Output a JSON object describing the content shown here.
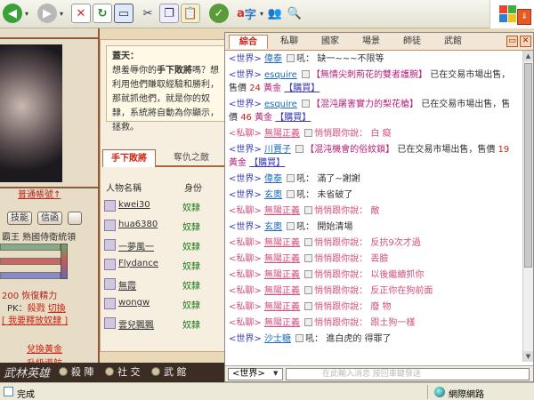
{
  "game": {
    "tab_number": "2",
    "left": {
      "link": "普通帳號↑",
      "buttons": [
        "技能",
        "信函"
      ],
      "king_line": "霸王 熟國侍衛統領",
      "vigor": "200 恢復精力",
      "pk_label": "PK：",
      "pk_value": "殺戮",
      "pk_switch": "切換",
      "release_link": "[ 我要釋放奴隸 ]",
      "gold_link": "兌換黃金",
      "upgrade_link": "升級導航"
    },
    "notice": {
      "title": "蓋天：",
      "text_before": "想羞辱你的",
      "text_bold": "手下敗將",
      "text_after": "嗎？想利用他們賺取經驗和勝利，那就抓他們，就是你的奴隸，系統將自動為你顯示，拯救。"
    },
    "subtabs": [
      "手下敗將",
      "奪仇之敵"
    ],
    "list_headers": [
      "人物名稱",
      "身份"
    ],
    "list_rows": [
      {
        "name": "kwei30",
        "status": "奴隸"
      },
      {
        "name": "hua6380",
        "status": "奴隸"
      },
      {
        "name": "一夢風一",
        "status": "奴隸"
      },
      {
        "name": "Flydance",
        "status": "奴隸"
      },
      {
        "name": "無霞",
        "status": "奴隸"
      },
      {
        "name": "wongw",
        "status": "奴隸"
      },
      {
        "name": "雲兒飄飄",
        "status": "奴隸"
      }
    ],
    "bottom_menu": [
      "殺 陣",
      "社 交",
      "武 館"
    ],
    "logo": "武林英雄"
  },
  "chat": {
    "tabs": [
      "綜合",
      "私聊",
      "國家",
      "場景",
      "師徒",
      "武館"
    ],
    "active_tab": "綜合",
    "channel": "<世界>",
    "input_placeholder": "在此輸入消息 按回車鍵發送",
    "messages": [
      {
        "type": "shout",
        "channel": "<世界>",
        "user": "偉泰",
        "verb": "吼：",
        "text": "缺一~~~不限等"
      },
      {
        "type": "trade",
        "channel": "<世界>",
        "user": "esquire",
        "item": "【無情尖刺荊花的雙者護腕】",
        "mid": "已在交易市場出售，售價",
        "price": "24",
        "unit": "黃金",
        "buy": "【購買】"
      },
      {
        "type": "trade",
        "channel": "<世界>",
        "user": "esquire",
        "item": "【混沌屠害實力的梨花槍】",
        "mid": "已在交易市場出售，售價",
        "price": "46",
        "unit": "黃金",
        "buy": "【購買】"
      },
      {
        "type": "private",
        "channel": "<私聊>",
        "user": "無陽正義",
        "verb": "悄悄跟你說：",
        "text": "白 癡"
      },
      {
        "type": "trade",
        "channel": "<世界>",
        "user": "川賈子",
        "item": "【混沌機會的俗紋鎖】",
        "mid": "已在交易市場出售，售價",
        "price": "19",
        "unit": "黃金",
        "buy": "【購買】"
      },
      {
        "type": "shout",
        "channel": "<世界>",
        "user": "偉泰",
        "verb": "吼：",
        "text": "滿了~謝謝"
      },
      {
        "type": "shout",
        "channel": "<世界>",
        "user": "玄奧",
        "verb": "吼：",
        "text": "未省破了"
      },
      {
        "type": "private",
        "channel": "<私聊>",
        "user": "無陽正義",
        "verb": "悄悄跟你說：",
        "text": "敵"
      },
      {
        "type": "shout",
        "channel": "<世界>",
        "user": "玄奧",
        "verb": "吼：",
        "text": "開始清場"
      },
      {
        "type": "private",
        "channel": "<私聊>",
        "user": "無陽正義",
        "verb": "悄悄跟你說：",
        "text": "反抗9次才過"
      },
      {
        "type": "private",
        "channel": "<私聊>",
        "user": "無陽正義",
        "verb": "悄悄跟你說：",
        "text": "丟臉"
      },
      {
        "type": "private",
        "channel": "<私聊>",
        "user": "無陽正義",
        "verb": "悄悄跟你說：",
        "text": "以後繼續抓你"
      },
      {
        "type": "private",
        "channel": "<私聊>",
        "user": "無陽正義",
        "verb": "悄悄跟你說：",
        "text": "反正你在狗前面"
      },
      {
        "type": "private",
        "channel": "<私聊>",
        "user": "無陽正義",
        "verb": "悄悄跟你說：",
        "text": "廢 物"
      },
      {
        "type": "private",
        "channel": "<私聊>",
        "user": "無陽正義",
        "verb": "悄悄跟你說：",
        "text": "跟土狗一樣"
      },
      {
        "type": "shout",
        "channel": "<世界>",
        "user": "沙士糖",
        "verb": "吼：",
        "text": "進白虎的 得罪了"
      }
    ]
  },
  "status": {
    "text": "完成",
    "zone": "網際網路"
  },
  "colors": {
    "chat_tab_active": "#cc2211",
    "world_channel": "#3a3ab5",
    "private_channel": "#d24f7f",
    "item_name": "#b4227b",
    "price": "#cc2211"
  }
}
